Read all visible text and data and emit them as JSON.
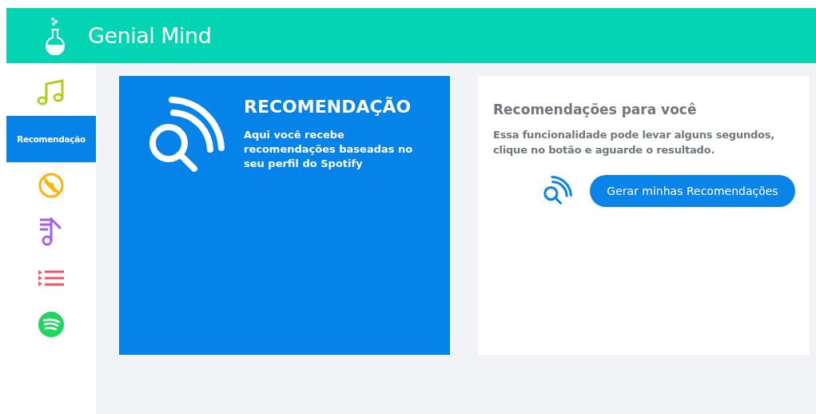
{
  "header": {
    "title": "Genial Mind"
  },
  "sidebar": {
    "items": [
      {
        "kind": "music",
        "selected": false
      },
      {
        "kind": "text",
        "label": "Recomendação",
        "selected": true
      },
      {
        "kind": "disc",
        "selected": false
      },
      {
        "kind": "playlist",
        "selected": false
      },
      {
        "kind": "queue",
        "selected": false
      },
      {
        "kind": "spotify",
        "selected": false
      }
    ]
  },
  "feature_card": {
    "title": "RECOMENDAÇÃO",
    "description": "Aqui você recebe recomendações baseadas no seu perfil do Spotify"
  },
  "action_card": {
    "title": "Recomendações para você",
    "description": "Essa funcionalidade pode levar alguns segundos, clique no botão e aguarde o resultado.",
    "button": "Gerar minhas Recomendações"
  }
}
